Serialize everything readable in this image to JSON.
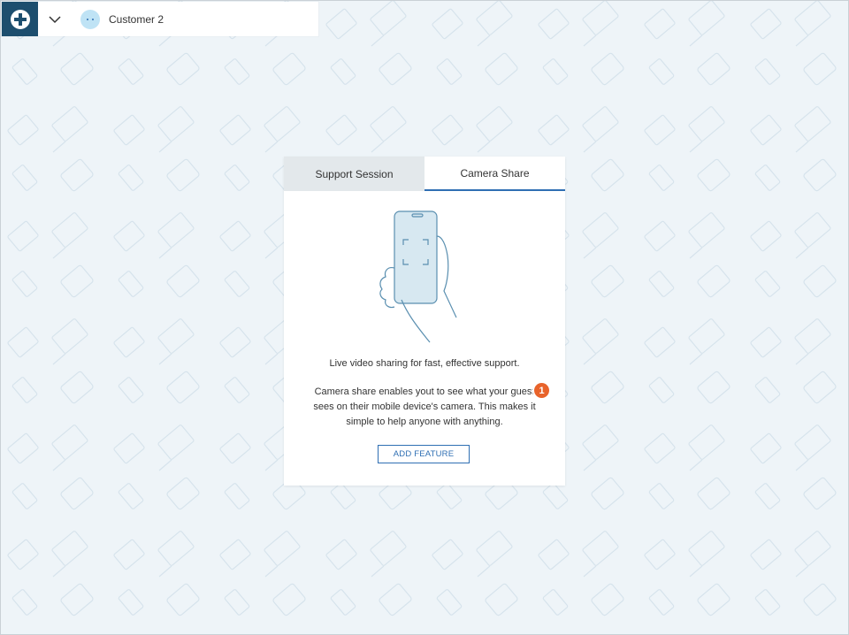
{
  "topbar": {
    "add_icon": "plus-circle-icon",
    "chevron_icon": "chevron-down-icon",
    "avatar_icon": "chat-bubble-icon",
    "customer_name": "Customer 2"
  },
  "card": {
    "tabs": [
      {
        "label": "Support Session",
        "active": false
      },
      {
        "label": "Camera Share",
        "active": true
      }
    ],
    "illustration_icon": "phone-in-hand-icon",
    "tagline": "Live video sharing for fast, effective support.",
    "description": "Camera share enables yout to see what your guest sees on their mobile device's camera. This makes it simple to help anyone with anything.",
    "button_label": "ADD FEATURE"
  },
  "marker": {
    "label": "1",
    "color": "#e8632b"
  },
  "colors": {
    "brand": "#1d4e6e",
    "accent": "#2f6fb3",
    "background": "#eef4f8"
  }
}
